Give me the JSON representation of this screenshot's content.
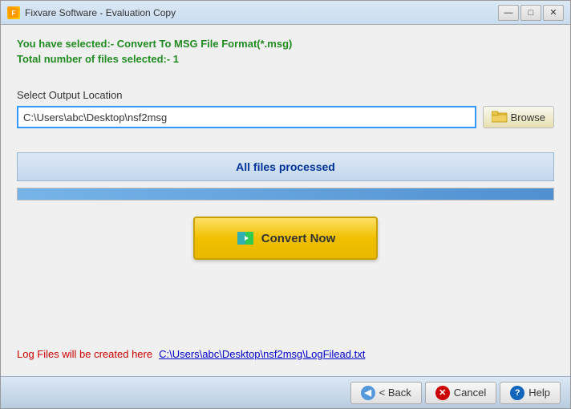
{
  "window": {
    "title": "Fixvare Software - Evaluation Copy",
    "icon": "F"
  },
  "info": {
    "line1": "You have selected:- Convert To MSG File Format(*.msg)",
    "line2": "Total number of files selected:- 1"
  },
  "output_section": {
    "label": "Select Output Location",
    "path_value": "C:\\Users\\abc\\Desktop\\nsf2msg",
    "path_placeholder": "C:\\Users\\abc\\Desktop\\nsf2msg",
    "browse_label": "Browse"
  },
  "status": {
    "text": "All files processed"
  },
  "convert_button": {
    "label": "Convert Now"
  },
  "log": {
    "label": "Log Files will be created here",
    "link_text": "C:\\Users\\abc\\Desktop\\nsf2msg\\LogFilead.txt"
  },
  "bottom_buttons": {
    "back": "< Back",
    "cancel": "Cancel",
    "help": "Help"
  }
}
